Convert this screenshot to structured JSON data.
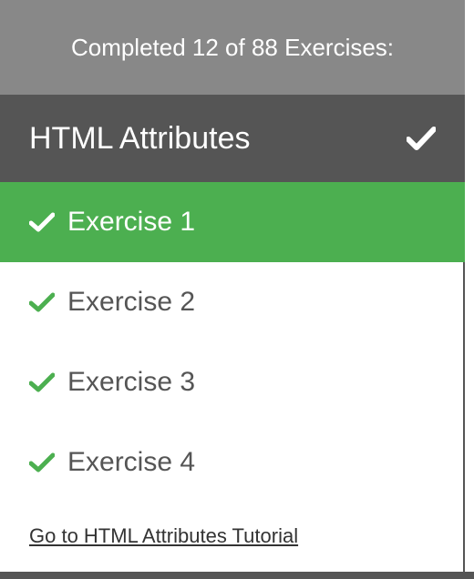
{
  "progress": {
    "text": "Completed 12 of 88 Exercises:"
  },
  "section": {
    "title": "HTML Attributes",
    "icon": "check-icon"
  },
  "exercises": [
    {
      "label": "Exercise 1",
      "active": true,
      "completed": true
    },
    {
      "label": "Exercise 2",
      "active": false,
      "completed": true
    },
    {
      "label": "Exercise 3",
      "active": false,
      "completed": true
    },
    {
      "label": "Exercise 4",
      "active": false,
      "completed": true
    }
  ],
  "tutorial_link": {
    "label": "Go to HTML Attributes Tutorial"
  },
  "colors": {
    "header_bg": "#888888",
    "section_bg": "#555555",
    "active_bg": "#4caf50",
    "check_green": "#4caf50",
    "text_gray": "#555555"
  }
}
